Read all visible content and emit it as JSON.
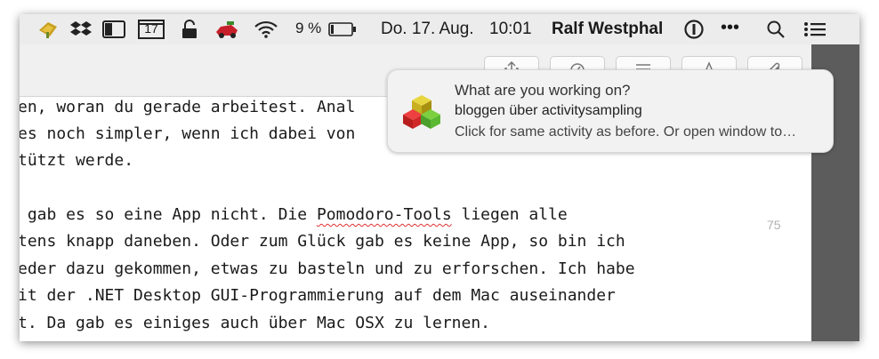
{
  "menubar": {
    "calendar_day": "17",
    "battery_percent": "9 %",
    "date": "Do. 17. Aug.",
    "time": "10:01",
    "user": "Ralf Westphal",
    "more": "•••"
  },
  "notification": {
    "title": "What are you working on?",
    "subtitle": "bloggen über activitysampling",
    "body": "Click for same activity as before. Or open window to…"
  },
  "editor": {
    "lines": [
      "en, woran du gerade arbeitest. Anal",
      "es noch simpler, wenn ich dabei von",
      "tützt werde.",
      "",
      " gab es so eine App nicht. Die ",
      "tens knapp daneben. Oder zum Glück gab es keine App, so bin ich",
      "eder dazu gekommen, etwas zu basteln und zu erforschen. Ich habe",
      "it der .NET Desktop GUI-Programmierung auf dem Mac auseinander",
      "t. Da gab es einiges auch über Mac OSX zu lernen."
    ],
    "misspelled_word": "Pomodoro-Tools",
    "line4_tail": " liegen alle",
    "line_number": "75"
  },
  "toolbar": {
    "buttons": [
      "share-icon",
      "stopwatch-icon",
      "list-icon",
      "font-icon",
      "attachment-icon"
    ]
  }
}
